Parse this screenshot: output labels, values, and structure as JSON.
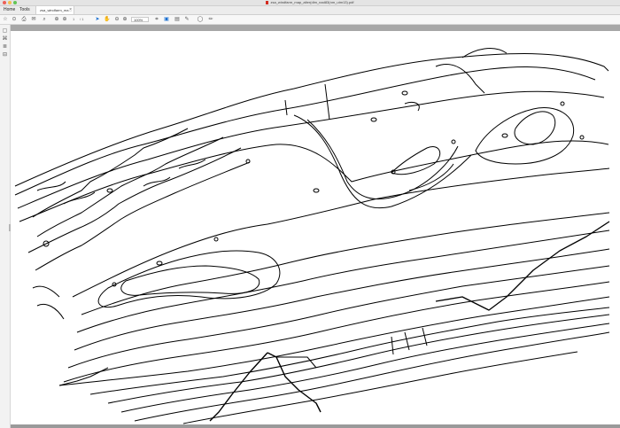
{
  "window": {
    "title": "zsa_windfarm_map_alter(dim_nad83(nm_utm13).pdf"
  },
  "tabs": {
    "home_label": "Home",
    "tools_label": "Tools",
    "document_label": "zsa_windfarm_ma...",
    "close_glyph": "×"
  },
  "toolbar": {
    "page_current": "1",
    "page_total": "/ 1",
    "zoom": "100%"
  },
  "icons": {
    "save": "save-icon",
    "upload": "upload-icon",
    "print": "printer-icon",
    "email": "email-icon",
    "search": "search-icon",
    "prev_page": "up-arrow-icon",
    "next_page": "down-arrow-icon",
    "select": "cursor-icon",
    "hand": "hand-icon",
    "zoom_out": "zoom-out-icon",
    "zoom_in": "zoom-in-icon",
    "crop": "crop-icon",
    "edit": "edit-pdf-icon",
    "export": "export-icon",
    "sign": "sign-icon",
    "comment": "comment-icon",
    "pen": "pen-icon"
  },
  "colors": {
    "contour": "#000000",
    "accent_blue": "#1a6fd1",
    "page_background": "#ffffff",
    "canvas_gray": "#9a9a9a"
  }
}
